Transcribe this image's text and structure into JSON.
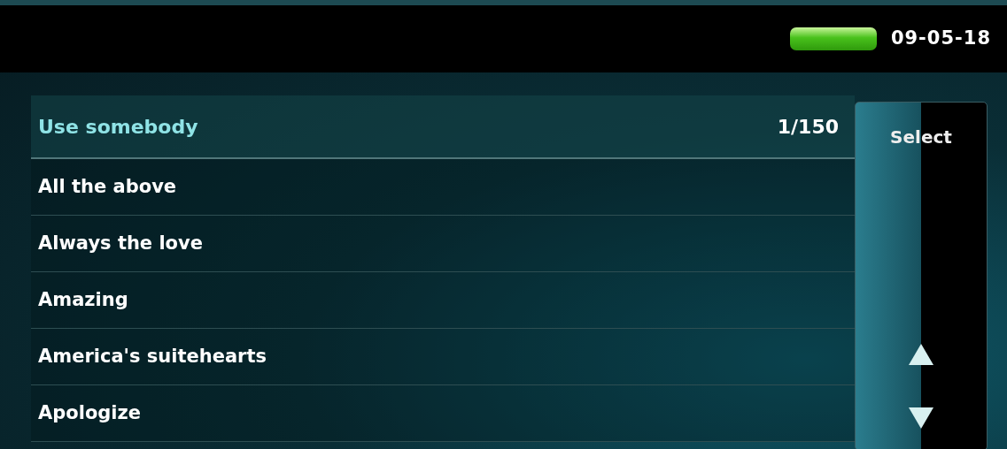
{
  "status_bar": {
    "date": "09-05-18"
  },
  "list": {
    "title": "Use somebody",
    "count": "1/150",
    "items": [
      {
        "label": "All the above"
      },
      {
        "label": "Always the love"
      },
      {
        "label": "Amazing"
      },
      {
        "label": "America's suitehearts"
      },
      {
        "label": "Apologize"
      }
    ]
  },
  "side_button": {
    "label": "Select"
  }
}
